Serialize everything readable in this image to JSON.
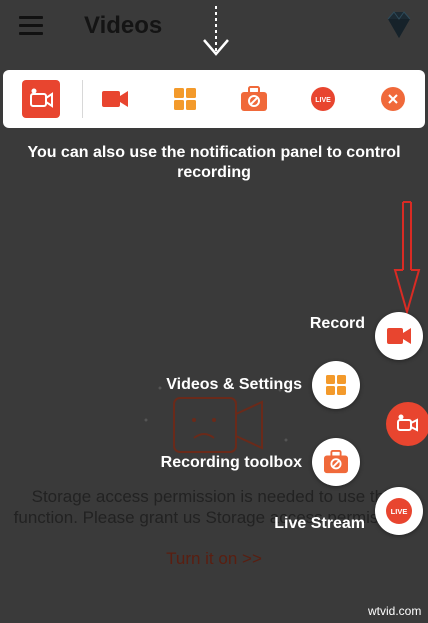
{
  "header": {
    "title": "Videos",
    "menu_icon": "hamburger-menu-icon",
    "premium_icon": "diamond-icon"
  },
  "notification_bar": {
    "items": [
      {
        "name": "app-icon",
        "color": "#e8452f"
      },
      {
        "name": "record-icon",
        "color": "#e8452f"
      },
      {
        "name": "videos-grid-icon",
        "color": "#f39a2b"
      },
      {
        "name": "toolbox-icon",
        "color": "#f0693a"
      },
      {
        "name": "live-icon",
        "label": "LIVE",
        "color": "#e8452f"
      },
      {
        "name": "close-icon",
        "color": "#f0693a"
      }
    ]
  },
  "hint": "You can also use the notification panel to control recording",
  "background": {
    "storage_message": "Storage access permission is needed to use this function. Please grant us Storage access permission.",
    "turn_on_link": "Turn it on >>"
  },
  "fab_menu": {
    "record_label": "Record",
    "videos_label": "Videos & Settings",
    "toolbox_label": "Recording toolbox",
    "live_label": "Live Stream",
    "live_icon_text": "LIVE"
  },
  "watermark": "wtvid.com",
  "colors": {
    "accent_red": "#e8452f",
    "accent_orange": "#f39a2b",
    "overlay": "#3a3a3a"
  }
}
